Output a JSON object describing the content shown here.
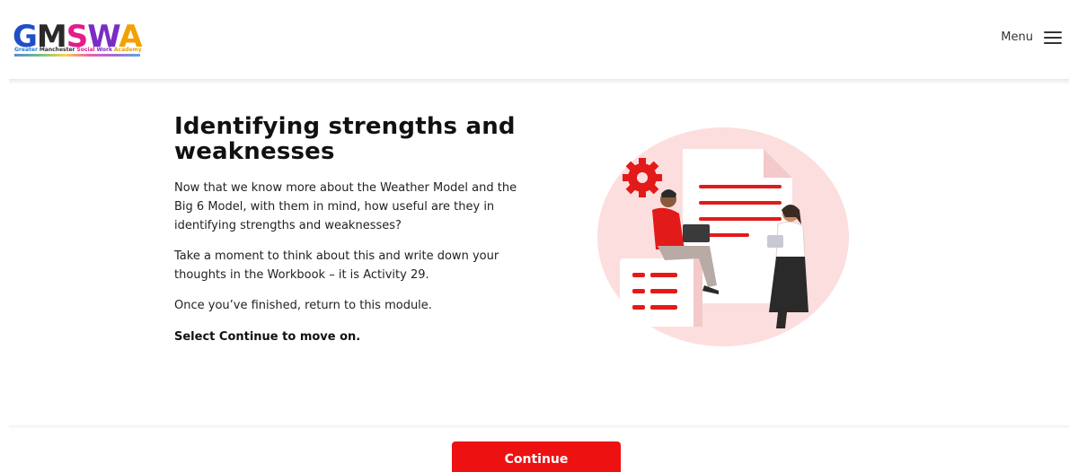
{
  "header": {
    "logo_text": [
      "G",
      "M",
      "S",
      "W",
      "A"
    ],
    "logo_subtitle": [
      "Greater",
      "Manchester",
      "Social",
      "Work",
      "Academy"
    ],
    "menu_label": "Menu"
  },
  "main": {
    "title": "Identifying strengths and weaknesses",
    "paragraphs": [
      "Now that we know more about the Weather Model and the Big 6 Model, with them in mind, how useful are they in identifying strengths and weaknesses?",
      "Take a moment to think about this and write down your thoughts in the Workbook – it is Activity 29.",
      "Once you’ve finished, return to this module.",
      "Select Continue to move on."
    ]
  },
  "footer": {
    "continue_label": "Continue"
  },
  "colors": {
    "accent": "#ee1111",
    "illustration_bg": "#fcdede"
  },
  "icons": [
    "hamburger-menu-icon",
    "gear-icon"
  ]
}
